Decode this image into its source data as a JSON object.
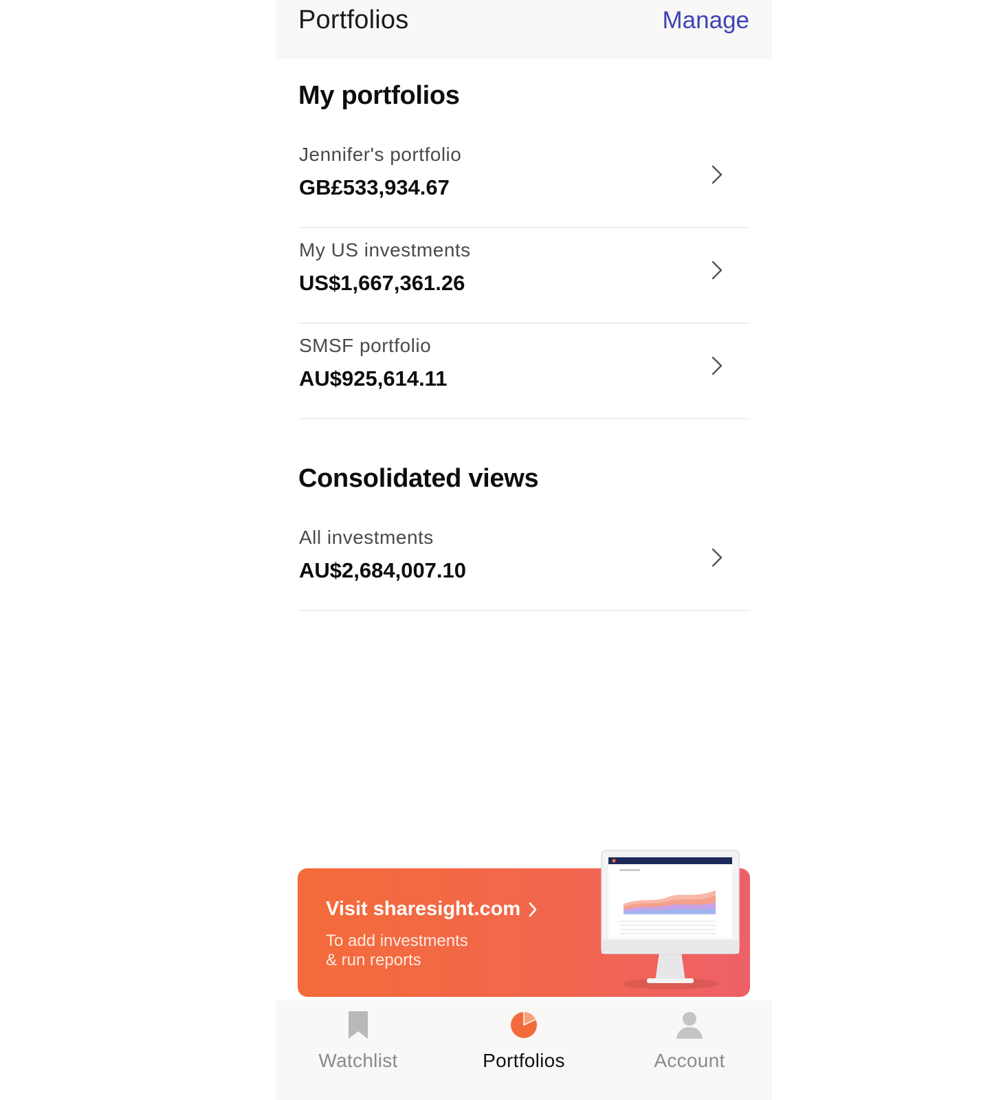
{
  "header": {
    "title": "Portfolios",
    "manage_label": "Manage"
  },
  "my_portfolios": {
    "title": "My portfolios",
    "items": [
      {
        "name": "Jennifer's portfolio",
        "value": "GB£533,934.67"
      },
      {
        "name": "My US investments",
        "value": "US$1,667,361.26"
      },
      {
        "name": "SMSF portfolio",
        "value": "AU$925,614.11"
      }
    ]
  },
  "consolidated": {
    "title": "Consolidated views",
    "items": [
      {
        "name": "All investments",
        "value": "AU$2,684,007.10"
      }
    ]
  },
  "promo": {
    "title": "Visit sharesight.com",
    "subtitle_line1": "To add investments",
    "subtitle_line2": "& run reports",
    "icon": "monitor-illustration"
  },
  "tabs": [
    {
      "label": "Watchlist",
      "icon": "bookmark-icon",
      "active": false
    },
    {
      "label": "Portfolios",
      "icon": "pie-chart-icon",
      "active": true
    },
    {
      "label": "Account",
      "icon": "person-icon",
      "active": false
    }
  ],
  "colors": {
    "accent_link": "#3d44b5",
    "brand_orange": "#f36b3a",
    "brand_pink": "#ee6068",
    "header_bg": "#f9f8f7"
  }
}
